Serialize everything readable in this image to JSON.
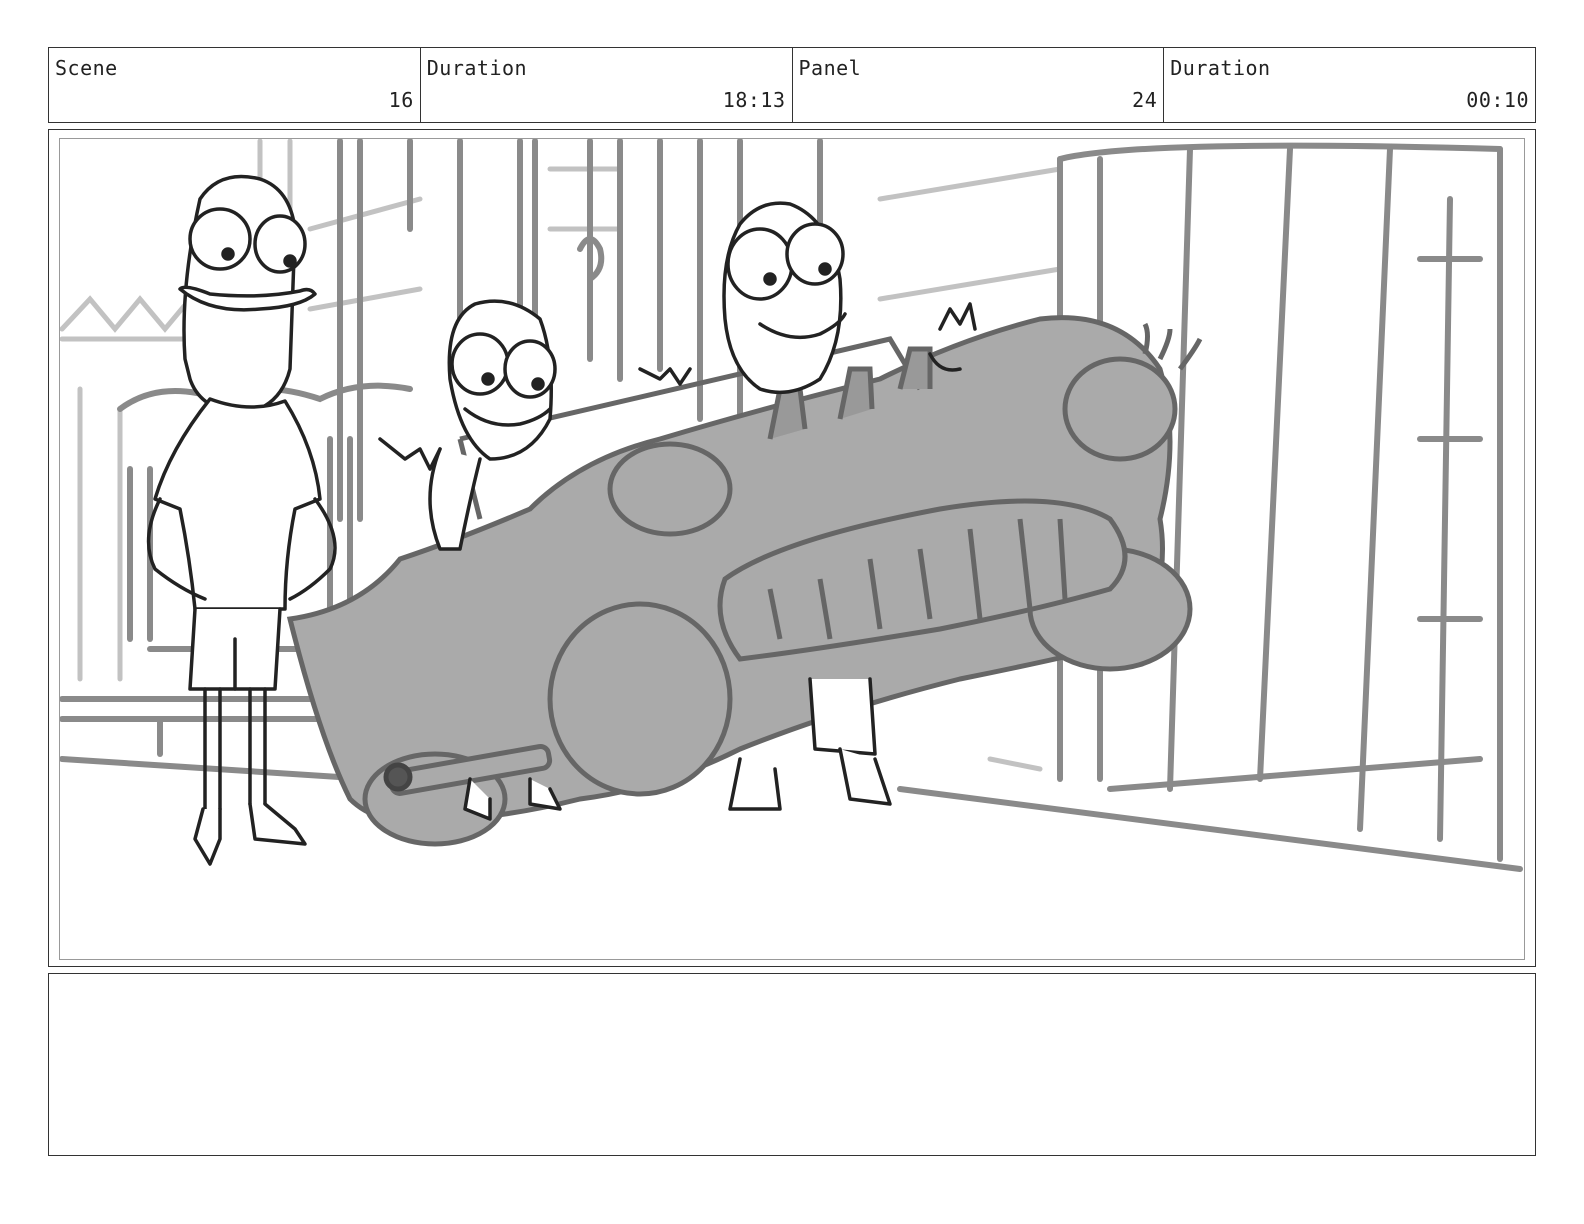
{
  "header": {
    "scene": {
      "label": "Scene",
      "value": "16"
    },
    "scene_duration": {
      "label": "Duration",
      "value": "18:13"
    },
    "panel": {
      "label": "Panel",
      "value": "24"
    },
    "panel_duration": {
      "label": "Duration",
      "value": "00:10"
    }
  },
  "panel_image": {
    "content": "sketch-drawing"
  },
  "notes": {
    "text": ""
  },
  "colors": {
    "border": "#333333",
    "inner_border": "#999999",
    "sketch_dark": "#222222",
    "sketch_mid": "#8a8a8a",
    "sketch_light": "#c2c2c2",
    "car_fill": "#aaaaaa"
  }
}
